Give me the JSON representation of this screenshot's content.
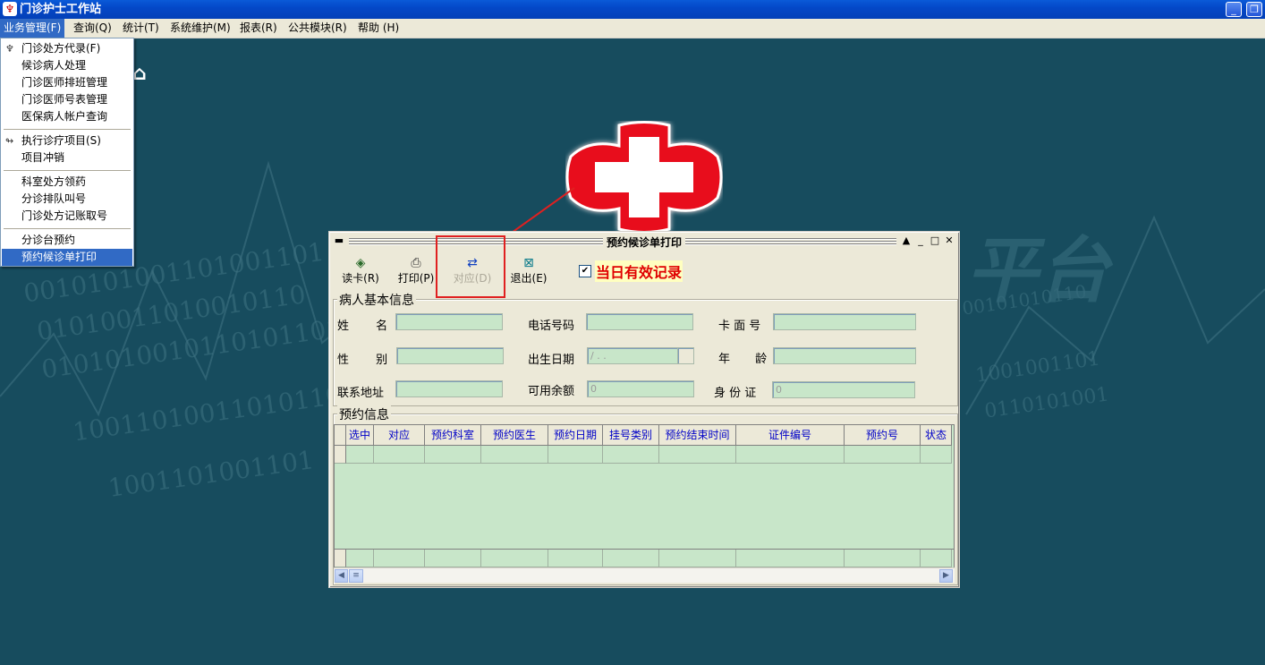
{
  "window": {
    "title": "门诊护士工作站",
    "app_icon": "stethoscope-app-icon"
  },
  "menubar": [
    {
      "label": "业务管理(F)",
      "active": true
    },
    {
      "label": "查询(Q)"
    },
    {
      "label": "统计(T)"
    },
    {
      "label": "系统维护(M)"
    },
    {
      "label": "报表(R)"
    },
    {
      "label": "公共模块(R)"
    },
    {
      "label": "帮助 (H)"
    }
  ],
  "dropdown": {
    "items": [
      "门诊处方代录(F)",
      "候诊病人处理",
      "门诊医师排班管理",
      "门诊医师号表管理",
      "医保病人帐户查询",
      "执行诊疗项目(S)",
      "项目冲销",
      "科室处方领药",
      "分诊排队叫号",
      "门诊处方记账取号",
      "分诊台预约",
      "预约候诊单打印"
    ],
    "selected": "预约候诊单打印"
  },
  "background": {
    "binary_lines": [
      "0010101001101001101",
      "01010011010010110",
      "0101010010110101101",
      "1001101001101011011",
      "1001101001101",
      "00101010110",
      "1001001101",
      "0110101001"
    ],
    "platform_text": "平台"
  },
  "child_window": {
    "title": "预约候诊单打印",
    "toolbar": {
      "read_card": "读卡(R)",
      "print": "打印(P)",
      "match": "对应(D)",
      "exit": "退出(E)"
    },
    "valid_today": {
      "label": "当日有效记录",
      "checked": true
    },
    "patient_group": {
      "title": "病人基本信息",
      "name_label": "姓 名",
      "phone_label": "电话号码",
      "card_label": "卡 面 号",
      "gender_label": "性 别",
      "birth_label": "出生日期",
      "birth_value": " /  .  .",
      "age_label": "年 龄",
      "address_label": "联系地址",
      "balance_label": "可用余额",
      "balance_value": "0",
      "id_label": "身 份 证",
      "id_value": "0"
    },
    "booking_group": {
      "title": "预约信息",
      "columns": [
        "选中",
        "对应",
        "预约科室",
        "预约医生",
        "预约日期",
        "挂号类别",
        "预约结束时间",
        "证件编号",
        "预约号",
        "状态"
      ]
    }
  },
  "colors": {
    "desktop": "#174c5e",
    "grid_fill": "#c8e6c9",
    "highlight": "#e02020",
    "menu_selection": "#316ac5"
  }
}
